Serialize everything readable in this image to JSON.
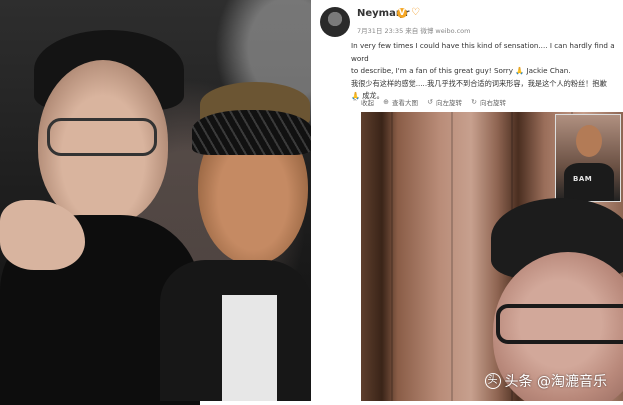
{
  "post": {
    "username": "NeymarJr",
    "verified_badge": "V",
    "meta": "7月31日 23:35 来自 微博 weibo.com",
    "text_lines": [
      "In very few times I could have this kind of sensation.... I can hardly find a word",
      "to describe, I'm a fan of this great guy!  Sorry 🙏 Jackie Chan.",
      "我很少有这样的感觉.....我几乎找不到合适的词来形容，我是这个人的粉丝！抱歉",
      "🙏 成龙。"
    ],
    "actions": [
      {
        "icon": "collapse-icon",
        "label": "收起"
      },
      {
        "icon": "view-large-icon",
        "label": "查看大图"
      },
      {
        "icon": "rotate-left-icon",
        "label": "向左旋转"
      },
      {
        "icon": "rotate-right-icon",
        "label": "向右旋转"
      }
    ]
  },
  "video": {
    "pip_shirt_text": "BAM"
  },
  "watermark": {
    "text": "头条 @淘漉音乐"
  },
  "icons": {
    "heart": "heart-icon",
    "verified": "verified-badge-icon",
    "watermark_logo": "toutiao-logo-icon"
  },
  "colors": {
    "username": "#333333",
    "meta": "#888888",
    "badge": "#f5a623",
    "action_text": "#666666"
  }
}
